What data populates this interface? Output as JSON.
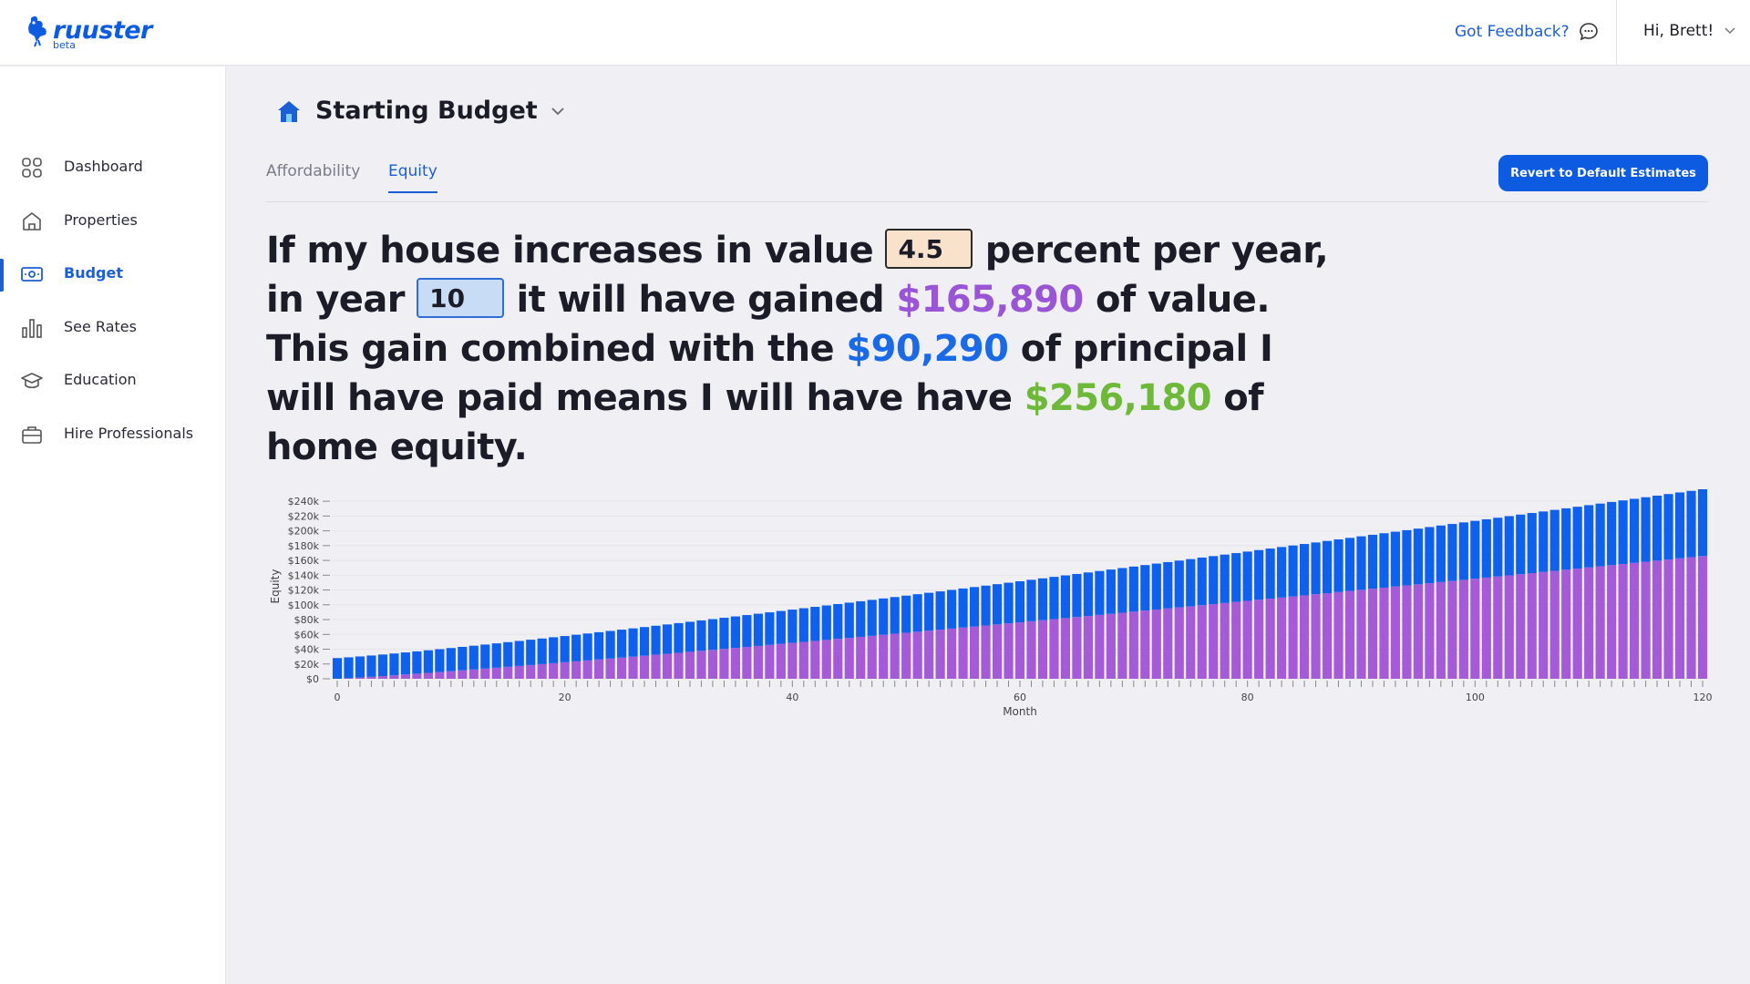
{
  "app": {
    "logo_text": "ruuster",
    "logo_badge": "beta",
    "brand_color": "#0d5be0"
  },
  "header": {
    "feedback_label": "Got Feedback?",
    "feedback_icon": "chat-bubble-icon",
    "user_label": "Hi, Brett!",
    "user_icon": "chevron-down-icon"
  },
  "sidebar": {
    "items": [
      {
        "label": "Dashboard",
        "icon": "dashboard-grid-icon",
        "active": false
      },
      {
        "label": "Properties",
        "icon": "home-icon",
        "active": false
      },
      {
        "label": "Budget",
        "icon": "money-icon",
        "active": true
      },
      {
        "label": "See Rates",
        "icon": "bar-chart-icon",
        "active": false
      },
      {
        "label": "Education",
        "icon": "graduation-cap-icon",
        "active": false
      },
      {
        "label": "Hire Professionals",
        "icon": "briefcase-icon",
        "active": false
      }
    ]
  },
  "page": {
    "title": "Starting Budget",
    "title_icon": "home-filled-icon",
    "tabs": [
      {
        "label": "Affordability",
        "active": false
      },
      {
        "label": "Equity",
        "active": true
      }
    ],
    "revert_label": "Revert to Default Estimates"
  },
  "sentence": {
    "part1": "If my house increases in value",
    "rate_value": "4.5",
    "part2": "percent per year, in year",
    "year_value": "10",
    "part3": "it will have gained",
    "gain_value": "$165,890",
    "part4": "of value. This gain combined with the",
    "principal_value": "$90,290",
    "part5": "of principal I will have paid means I will have have",
    "equity_value": "$256,180",
    "part6": "of home equity.",
    "colors": {
      "gain": "#9a55d6",
      "principal": "#1a6ae8",
      "equity": "#6eb83a"
    }
  },
  "chart_data": {
    "type": "bar",
    "stacked": true,
    "xlabel": "Month",
    "ylabel": "Equity",
    "xlim": [
      0,
      120
    ],
    "ylim": [
      0,
      250000
    ],
    "x_ticks": [
      0,
      20,
      40,
      60,
      80,
      100,
      120
    ],
    "y_ticks": [
      "$0",
      "$20k",
      "$40k",
      "$60k",
      "$80k",
      "$100k",
      "$120k",
      "$140k",
      "$160k",
      "$180k",
      "$200k",
      "$220k",
      "$240k"
    ],
    "series": [
      {
        "color": "#a55ad8",
        "start": 0,
        "end": 165890
      },
      {
        "color": "#1060ee",
        "start": 28000,
        "end": 90290
      }
    ],
    "grid": true
  }
}
